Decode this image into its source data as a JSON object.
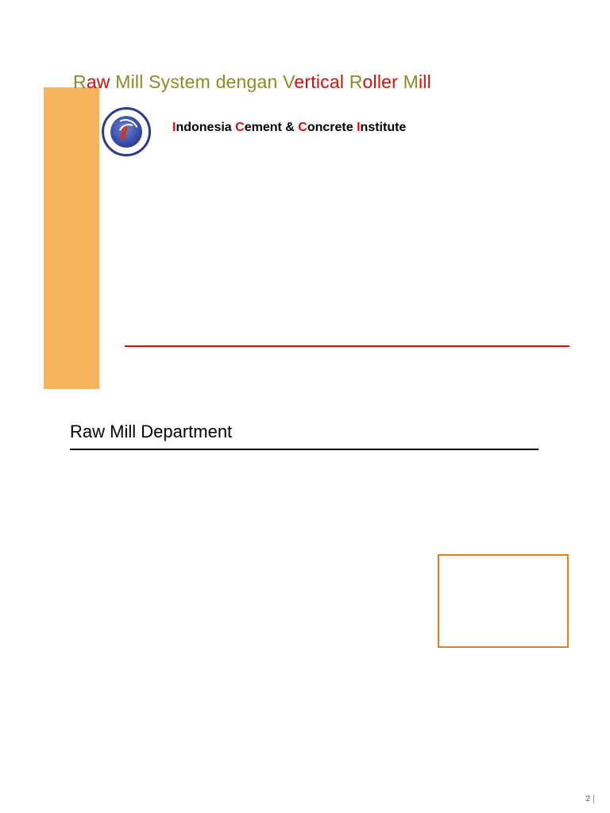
{
  "slide1": {
    "title_parts": {
      "p1": "R",
      "p2": "aw ",
      "p3": "M",
      "p4": "ill System dengan V",
      "p5": "ertical ",
      "p6": "R",
      "p7": "oller ",
      "p8": "M",
      "p9": "ill"
    },
    "subtitle_parts": {
      "s1": "I",
      "s2": "ndonesia ",
      "s3": "C",
      "s4": "ement & ",
      "s5": "C",
      "s6": "oncrete ",
      "s7": "I",
      "s8": "nstitute"
    }
  },
  "slide2": {
    "heading": "Raw Mill Department"
  },
  "page_number": "2"
}
